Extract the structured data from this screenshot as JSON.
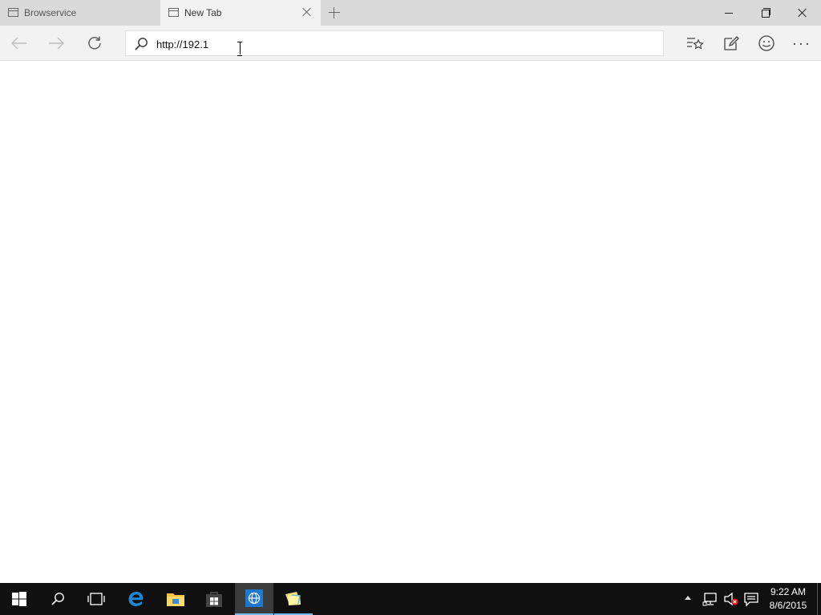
{
  "browser": {
    "tabs": [
      {
        "label": "Browservice",
        "active": false
      },
      {
        "label": "New Tab",
        "active": true
      }
    ],
    "address_bar": {
      "value": "http://192.1"
    },
    "toolbar": {
      "more_label": "···"
    }
  },
  "taskbar": {
    "clock": {
      "time": "9:22 AM",
      "date": "8/6/2015"
    }
  },
  "colors": {
    "tab_strip": "#dadada",
    "active_tab": "#f2f2f2",
    "taskbar": "#101010",
    "taskbar_accent": "#76b9ed",
    "edge_blue": "#1e88d8"
  }
}
